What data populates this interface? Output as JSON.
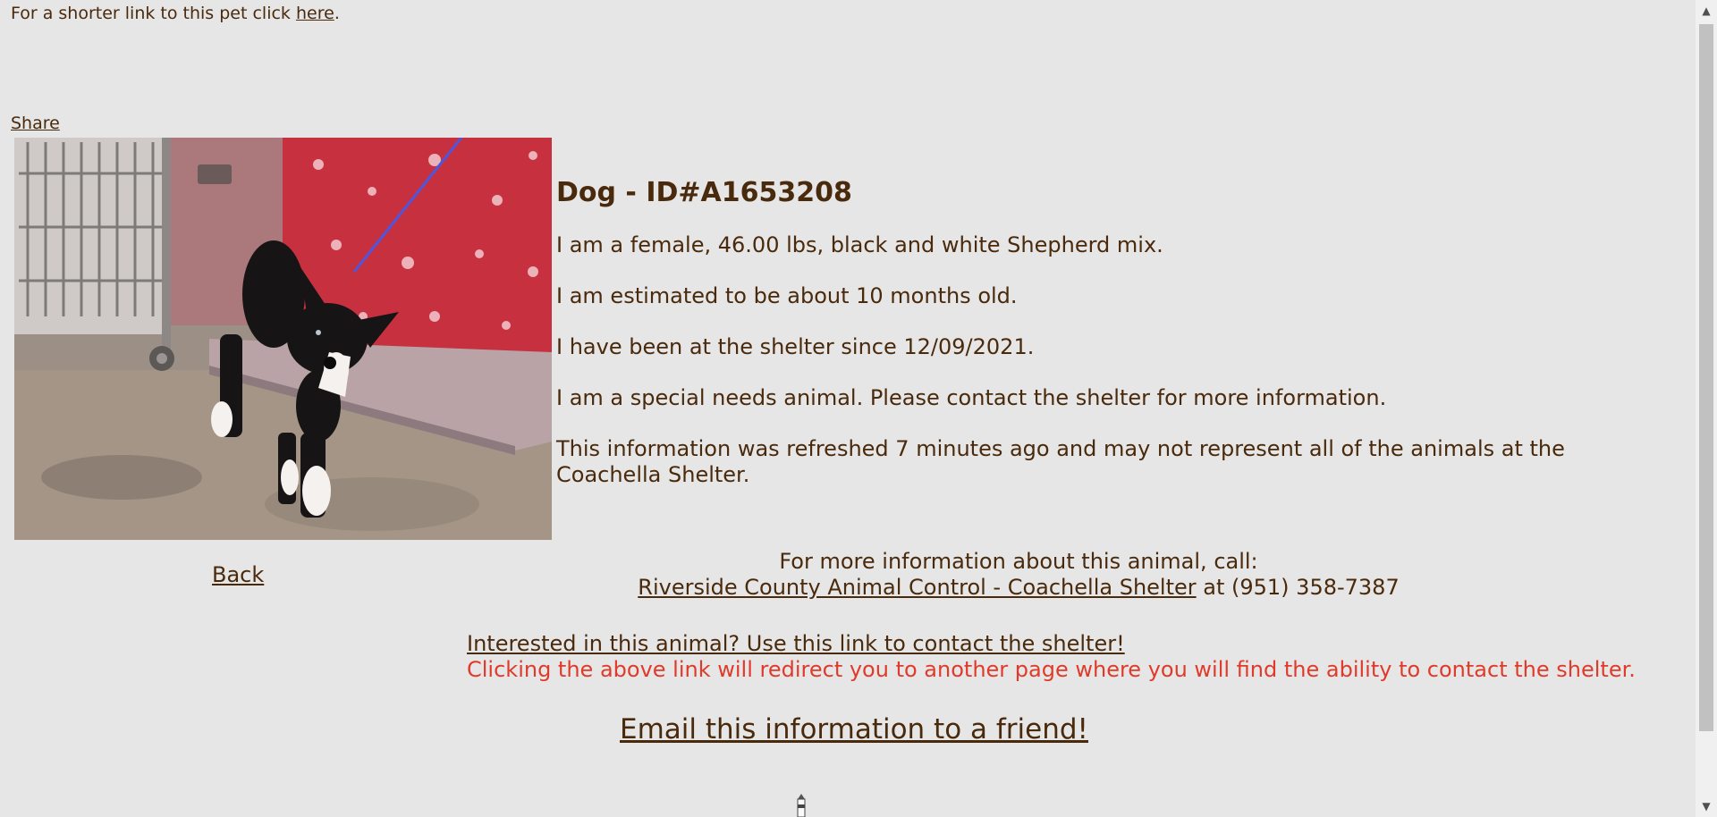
{
  "top": {
    "shortlink_prefix": "For a shorter link to this pet click ",
    "shortlink_link": "here",
    "shortlink_suffix": ".",
    "share": "Share"
  },
  "animal": {
    "title": "Dog - ID#A1653208",
    "lines": [
      "I am a female, 46.00 lbs, black and white Shepherd mix.",
      "I am estimated to be about 10 months old.",
      "I have been at the shelter since 12/09/2021.",
      "I am a special needs animal. Please contact the shelter for more information.",
      "This information was refreshed 7 minutes ago and may not represent all of the animals at the Coachella Shelter."
    ]
  },
  "nav": {
    "back": "Back"
  },
  "call": {
    "heading": "For more information about this animal, call:",
    "shelter_link": "Riverside County Animal Control - Coachella Shelter",
    "phone_text": " at (951) 358-7387"
  },
  "contact": {
    "link": "Interested in this animal? Use this link to contact the shelter!",
    "note": "Clicking the above link will redirect you to another page where you will find the ability to contact the shelter."
  },
  "email": {
    "link": "Email this information to a friend!"
  },
  "colors": {
    "background": "#e6e6e6",
    "text": "#4a2a0c",
    "note": "#e03a2a"
  },
  "icons": {
    "photo": "dog-photo",
    "footer": "lighthouse-icon",
    "scroll_up": "chevron-up-icon",
    "scroll_down": "chevron-down-icon"
  }
}
